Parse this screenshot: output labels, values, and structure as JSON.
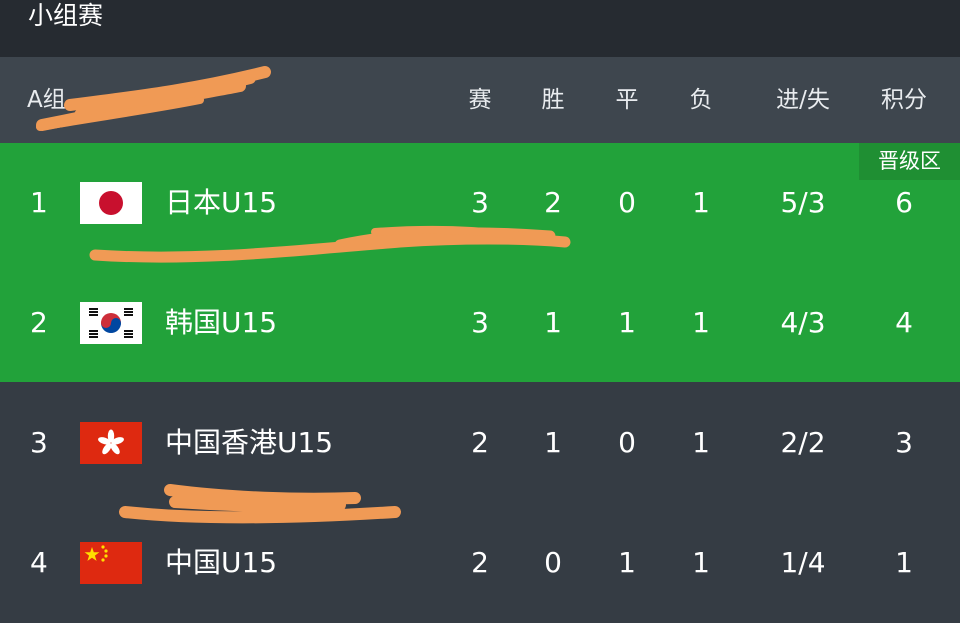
{
  "section_title": "小组赛",
  "group_label": "A组",
  "columns": {
    "played": "赛",
    "won": "胜",
    "drawn": "平",
    "lost": "负",
    "goals": "进/失",
    "points": "积分"
  },
  "qualified_badge": "晋级区",
  "colors": {
    "topbar": "#262b31",
    "header": "#3e464e",
    "body": "#353c44",
    "qualified": "#22a23a",
    "badge": "#1f8f33",
    "scribble": "#f09a55"
  },
  "rows": [
    {
      "rank": "1",
      "flag": "japan-flag",
      "team": "日本U15",
      "played": "3",
      "won": "2",
      "drawn": "0",
      "lost": "1",
      "goals": "5/3",
      "points": "6"
    },
    {
      "rank": "2",
      "flag": "korea-flag",
      "team": "韩国U15",
      "played": "3",
      "won": "1",
      "drawn": "1",
      "lost": "1",
      "goals": "4/3",
      "points": "4"
    },
    {
      "rank": "3",
      "flag": "hong-kong-flag",
      "team": "中国香港U15",
      "played": "2",
      "won": "1",
      "drawn": "0",
      "lost": "1",
      "goals": "2/2",
      "points": "3"
    },
    {
      "rank": "4",
      "flag": "china-flag",
      "team": "中国U15",
      "played": "2",
      "won": "0",
      "drawn": "1",
      "lost": "1",
      "goals": "1/4",
      "points": "1"
    }
  ]
}
